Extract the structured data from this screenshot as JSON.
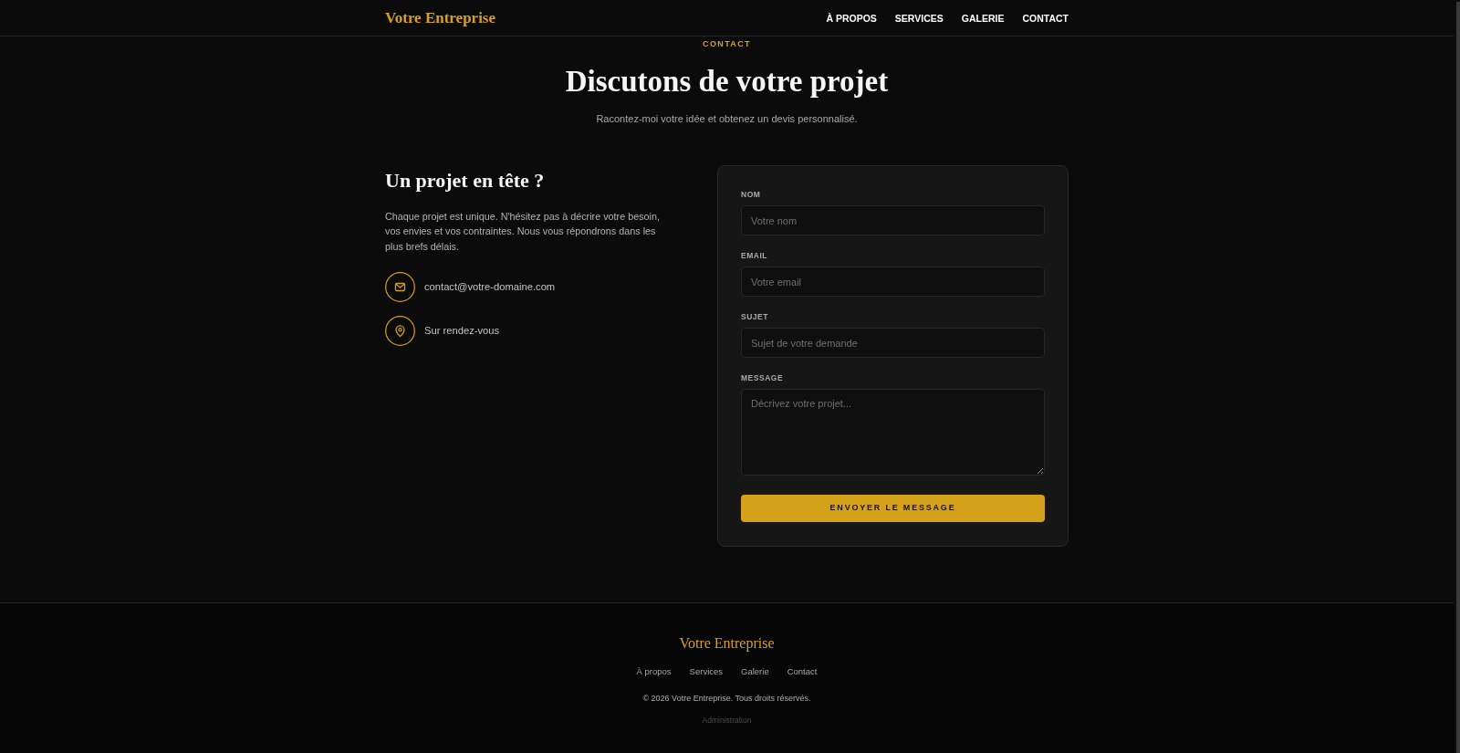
{
  "header": {
    "logo": "Votre Entreprise",
    "nav": [
      "À PROPOS",
      "SERVICES",
      "GALERIE",
      "CONTACT"
    ]
  },
  "hero": {
    "eyebrow": "CONTACT",
    "title": "Discutons de votre projet",
    "subtitle": "Racontez-moi votre idée et obtenez un devis personnalisé."
  },
  "intro": {
    "heading": "Un projet en tête ?",
    "text": "Chaque projet est unique. N'hésitez pas à décrire votre besoin, vos envies et vos contraintes. Nous vous répondrons dans les plus brefs délais.",
    "contacts": [
      {
        "kind": "email",
        "text": "contact@votre-domaine.com"
      },
      {
        "kind": "location",
        "text": "Sur rendez-vous"
      }
    ]
  },
  "form": {
    "fields": [
      {
        "kind": "input",
        "label": "NOM",
        "placeholder": "Votre nom"
      },
      {
        "kind": "input",
        "label": "EMAIL",
        "placeholder": "Votre email"
      },
      {
        "kind": "input",
        "label": "SUJET",
        "placeholder": "Sujet de votre demande"
      },
      {
        "kind": "textarea",
        "label": "MESSAGE",
        "placeholder": "Décrivez votre projet..."
      }
    ],
    "submit": "ENVOYER LE MESSAGE"
  },
  "footer": {
    "logo": "Votre Entreprise",
    "links": [
      "À propos",
      "Services",
      "Galerie",
      "Contact"
    ],
    "copyright": "© 2026 Votre Entreprise. Tous droits réservés.",
    "admin_link": "Administration"
  }
}
